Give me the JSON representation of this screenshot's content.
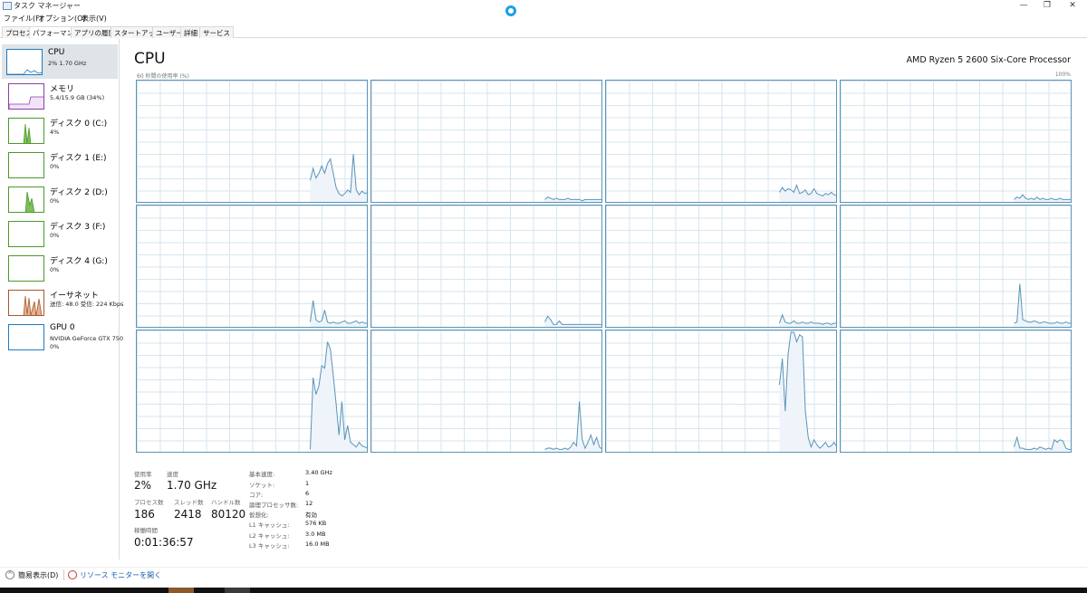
{
  "window": {
    "title": "タスク マネージャー",
    "minimize_glyph": "—",
    "maximize_glyph": "❐",
    "close_glyph": "✕"
  },
  "menu": [
    "ファイル(F)",
    "オプション(O)",
    "表示(V)"
  ],
  "tabs": [
    "プロセス",
    "パフォーマンス",
    "アプリの履歴",
    "スタートアップ",
    "ユーザー",
    "詳細",
    "サービス"
  ],
  "active_tab": "パフォーマンス",
  "sidebar": [
    {
      "name": "CPU",
      "sub": "2%  1.70 GHz",
      "sub2": "",
      "color": "#1f7bbf",
      "active": true
    },
    {
      "name": "メモリ",
      "sub": "5.4/15.9 GB (34%)",
      "sub2": "",
      "color": "#8b3fa8",
      "active": false
    },
    {
      "name": "ディスク 0 (C:)",
      "sub": "4%",
      "sub2": "",
      "color": "#4c9a2a",
      "active": false
    },
    {
      "name": "ディスク 1 (E:)",
      "sub": "0%",
      "sub2": "",
      "color": "#4c9a2a",
      "active": false
    },
    {
      "name": "ディスク 2 (D:)",
      "sub": "0%",
      "sub2": "",
      "color": "#4c9a2a",
      "active": false
    },
    {
      "name": "ディスク 3 (F:)",
      "sub": "0%",
      "sub2": "",
      "color": "#4c9a2a",
      "active": false
    },
    {
      "name": "ディスク 4 (G:)",
      "sub": "0%",
      "sub2": "",
      "color": "#4c9a2a",
      "active": false
    },
    {
      "name": "イーサネット",
      "sub": "送信: 48.0 受信: 224 Kbps",
      "sub2": "",
      "color": "#a7582a",
      "active": false
    },
    {
      "name": "GPU 0",
      "sub": "NVIDIA GeForce GTX 750",
      "sub2": "0%",
      "color": "#1f7bbf",
      "active": false
    }
  ],
  "main": {
    "title": "CPU",
    "processor": "AMD Ryzen 5 2600 Six-Core Processor",
    "y_axis_label": "60 秒間の使用率 (%)",
    "y_axis_max": "100%",
    "line_color": "#5a94b8",
    "fill_color": "#eef4f9"
  },
  "cores": [
    [
      0,
      0,
      0,
      0,
      0,
      0,
      0,
      0,
      0,
      0,
      0,
      0,
      0,
      0,
      0,
      0,
      0,
      0,
      0,
      0,
      0,
      0,
      0,
      0,
      0,
      0,
      0,
      0,
      0,
      0,
      0,
      0,
      0,
      0,
      0,
      0,
      0,
      0,
      0,
      0,
      0,
      0,
      0,
      0,
      0,
      0,
      0,
      0,
      0,
      0,
      0,
      0,
      0,
      0,
      0,
      0,
      0,
      0,
      0,
      0,
      18,
      28,
      20,
      24,
      30,
      24,
      32,
      36,
      24,
      12,
      7,
      5,
      7,
      10,
      8,
      40,
      10,
      6,
      9,
      7,
      8
    ],
    [
      0,
      0,
      0,
      0,
      0,
      0,
      0,
      0,
      0,
      0,
      0,
      0,
      0,
      0,
      0,
      0,
      0,
      0,
      0,
      0,
      0,
      0,
      0,
      0,
      0,
      0,
      0,
      0,
      0,
      0,
      0,
      0,
      0,
      0,
      0,
      0,
      0,
      0,
      0,
      0,
      0,
      0,
      0,
      0,
      0,
      0,
      0,
      0,
      0,
      0,
      0,
      0,
      0,
      0,
      0,
      0,
      0,
      0,
      0,
      0,
      2,
      4,
      3,
      2,
      3,
      2,
      2,
      2,
      3,
      2,
      2,
      2,
      2,
      1,
      2,
      2,
      2,
      2,
      2,
      2,
      2
    ],
    [
      0,
      0,
      0,
      0,
      0,
      0,
      0,
      0,
      0,
      0,
      0,
      0,
      0,
      0,
      0,
      0,
      0,
      0,
      0,
      0,
      0,
      0,
      0,
      0,
      0,
      0,
      0,
      0,
      0,
      0,
      0,
      0,
      0,
      0,
      0,
      0,
      0,
      0,
      0,
      0,
      0,
      0,
      0,
      0,
      0,
      0,
      0,
      0,
      0,
      0,
      0,
      0,
      0,
      0,
      0,
      0,
      0,
      0,
      0,
      0,
      8,
      12,
      9,
      11,
      10,
      8,
      14,
      7,
      8,
      10,
      6,
      7,
      11,
      7,
      6,
      5,
      7,
      6,
      8,
      6,
      5
    ],
    [
      0,
      0,
      0,
      0,
      0,
      0,
      0,
      0,
      0,
      0,
      0,
      0,
      0,
      0,
      0,
      0,
      0,
      0,
      0,
      0,
      0,
      0,
      0,
      0,
      0,
      0,
      0,
      0,
      0,
      0,
      0,
      0,
      0,
      0,
      0,
      0,
      0,
      0,
      0,
      0,
      0,
      0,
      0,
      0,
      0,
      0,
      0,
      0,
      0,
      0,
      0,
      0,
      0,
      0,
      0,
      0,
      0,
      0,
      0,
      0,
      2,
      4,
      3,
      6,
      3,
      2,
      3,
      2,
      4,
      2,
      3,
      2,
      2,
      3,
      2,
      2,
      3,
      2,
      2,
      2,
      2
    ],
    [
      0,
      0,
      0,
      0,
      0,
      0,
      0,
      0,
      0,
      0,
      0,
      0,
      0,
      0,
      0,
      0,
      0,
      0,
      0,
      0,
      0,
      0,
      0,
      0,
      0,
      0,
      0,
      0,
      0,
      0,
      0,
      0,
      0,
      0,
      0,
      0,
      0,
      0,
      0,
      0,
      0,
      0,
      0,
      0,
      0,
      0,
      0,
      0,
      0,
      0,
      0,
      0,
      0,
      0,
      0,
      0,
      0,
      0,
      0,
      0,
      4,
      22,
      6,
      4,
      5,
      14,
      4,
      3,
      4,
      3,
      3,
      4,
      5,
      3,
      3,
      4,
      5,
      3,
      4,
      3,
      3
    ],
    [
      0,
      0,
      0,
      0,
      0,
      0,
      0,
      0,
      0,
      0,
      0,
      0,
      0,
      0,
      0,
      0,
      0,
      0,
      0,
      0,
      0,
      0,
      0,
      0,
      0,
      0,
      0,
      0,
      0,
      0,
      0,
      0,
      0,
      0,
      0,
      0,
      0,
      0,
      0,
      0,
      0,
      0,
      0,
      0,
      0,
      0,
      0,
      0,
      0,
      0,
      0,
      0,
      0,
      0,
      0,
      0,
      0,
      0,
      0,
      0,
      4,
      9,
      6,
      2,
      2,
      5,
      2,
      2,
      2,
      2,
      2,
      2,
      2,
      2,
      2,
      2,
      2,
      2,
      2,
      2,
      2
    ],
    [
      0,
      0,
      0,
      0,
      0,
      0,
      0,
      0,
      0,
      0,
      0,
      0,
      0,
      0,
      0,
      0,
      0,
      0,
      0,
      0,
      0,
      0,
      0,
      0,
      0,
      0,
      0,
      0,
      0,
      0,
      0,
      0,
      0,
      0,
      0,
      0,
      0,
      0,
      0,
      0,
      0,
      0,
      0,
      0,
      0,
      0,
      0,
      0,
      0,
      0,
      0,
      0,
      0,
      0,
      0,
      0,
      0,
      0,
      0,
      0,
      3,
      10,
      4,
      3,
      3,
      5,
      3,
      3,
      4,
      3,
      3,
      4,
      3,
      3,
      3,
      2,
      3,
      3,
      2,
      3,
      3
    ],
    [
      0,
      0,
      0,
      0,
      0,
      0,
      0,
      0,
      0,
      0,
      0,
      0,
      0,
      0,
      0,
      0,
      0,
      0,
      0,
      0,
      0,
      0,
      0,
      0,
      0,
      0,
      0,
      0,
      0,
      0,
      0,
      0,
      0,
      0,
      0,
      0,
      0,
      0,
      0,
      0,
      0,
      0,
      0,
      0,
      0,
      0,
      0,
      0,
      0,
      0,
      0,
      0,
      0,
      0,
      0,
      0,
      0,
      0,
      0,
      0,
      3,
      4,
      36,
      6,
      5,
      4,
      4,
      5,
      4,
      3,
      4,
      4,
      3,
      3,
      3,
      4,
      3,
      3,
      4,
      3,
      3
    ],
    [
      0,
      0,
      0,
      0,
      0,
      0,
      0,
      0,
      0,
      0,
      0,
      0,
      0,
      0,
      0,
      0,
      0,
      0,
      0,
      0,
      0,
      0,
      0,
      0,
      0,
      0,
      0,
      0,
      0,
      0,
      0,
      0,
      0,
      0,
      0,
      0,
      0,
      0,
      0,
      0,
      0,
      0,
      0,
      0,
      0,
      0,
      0,
      0,
      0,
      0,
      0,
      0,
      0,
      0,
      0,
      0,
      0,
      0,
      0,
      0,
      2,
      62,
      48,
      55,
      72,
      70,
      92,
      86,
      64,
      40,
      14,
      42,
      10,
      22,
      8,
      6,
      4,
      8,
      5,
      4,
      3
    ],
    [
      0,
      0,
      0,
      0,
      0,
      0,
      0,
      0,
      0,
      0,
      0,
      0,
      0,
      0,
      0,
      0,
      0,
      0,
      0,
      0,
      0,
      0,
      0,
      0,
      0,
      0,
      0,
      0,
      0,
      0,
      0,
      0,
      0,
      0,
      0,
      0,
      0,
      0,
      0,
      0,
      0,
      0,
      0,
      0,
      0,
      0,
      0,
      0,
      0,
      0,
      0,
      0,
      0,
      0,
      0,
      0,
      0,
      0,
      0,
      0,
      2,
      3,
      3,
      2,
      3,
      2,
      2,
      3,
      2,
      4,
      8,
      5,
      42,
      10,
      3,
      8,
      14,
      6,
      12,
      4,
      2
    ],
    [
      0,
      0,
      0,
      0,
      0,
      0,
      0,
      0,
      0,
      0,
      0,
      0,
      0,
      0,
      0,
      0,
      0,
      0,
      0,
      0,
      0,
      0,
      0,
      0,
      0,
      0,
      0,
      0,
      0,
      0,
      0,
      0,
      0,
      0,
      0,
      0,
      0,
      0,
      0,
      0,
      0,
      0,
      0,
      0,
      0,
      0,
      0,
      0,
      0,
      0,
      0,
      0,
      0,
      0,
      0,
      0,
      0,
      0,
      0,
      0,
      56,
      78,
      34,
      82,
      100,
      100,
      92,
      98,
      96,
      34,
      12,
      4,
      10,
      6,
      3,
      5,
      8,
      4,
      5,
      8,
      4
    ],
    [
      0,
      0,
      0,
      0,
      0,
      0,
      0,
      0,
      0,
      0,
      0,
      0,
      0,
      0,
      0,
      0,
      0,
      0,
      0,
      0,
      0,
      0,
      0,
      0,
      0,
      0,
      0,
      0,
      0,
      0,
      0,
      0,
      0,
      0,
      0,
      0,
      0,
      0,
      0,
      0,
      0,
      0,
      0,
      0,
      0,
      0,
      0,
      0,
      0,
      0,
      0,
      0,
      0,
      0,
      0,
      0,
      0,
      0,
      0,
      0,
      4,
      12,
      3,
      3,
      2,
      2,
      2,
      3,
      2,
      4,
      3,
      2,
      3,
      2,
      10,
      8,
      10,
      9,
      3,
      2,
      2
    ]
  ],
  "stats": {
    "usage_label": "使用率",
    "usage_value": "2%",
    "speed_label": "速度",
    "speed_value": "1.70 GHz",
    "processes_label": "プロセス数",
    "processes_value": "186",
    "threads_label": "スレッド数",
    "threads_value": "2418",
    "handles_label": "ハンドル数",
    "handles_value": "80120",
    "uptime_label": "稼働時間",
    "uptime_value": "0:01:36:57"
  },
  "specs": [
    {
      "label": "基本速度:",
      "value": "3.40 GHz"
    },
    {
      "label": "ソケット:",
      "value": "1"
    },
    {
      "label": "コア:",
      "value": "6"
    },
    {
      "label": "論理プロセッサ数:",
      "value": "12"
    },
    {
      "label": "仮想化:",
      "value": "有効"
    },
    {
      "label": "L1 キャッシュ:",
      "value": "576 KB"
    },
    {
      "label": "L2 キャッシュ:",
      "value": "3.0 MB"
    },
    {
      "label": "L3 キャッシュ:",
      "value": "16.0 MB"
    }
  ],
  "footer": {
    "compact_label": "簡易表示(D)",
    "resource_monitor_label": "リソース モニターを開く"
  }
}
